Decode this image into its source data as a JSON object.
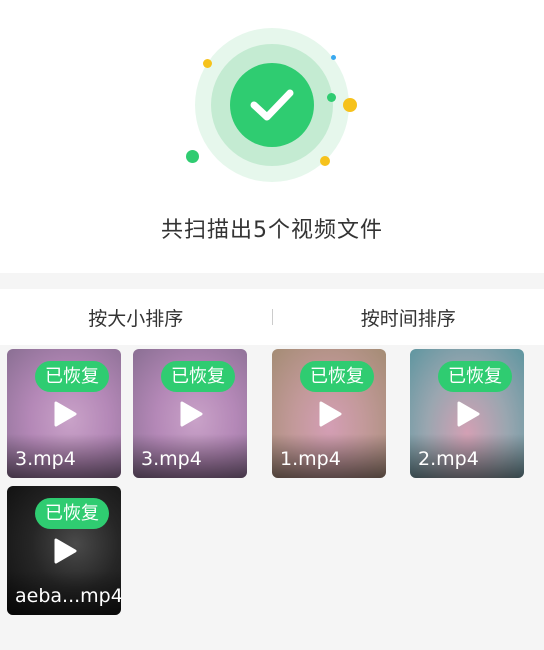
{
  "result": {
    "message": "共扫描出5个视频文件",
    "icon": "check-circle-icon",
    "accent_color": "#2fcc71"
  },
  "sort_tabs": [
    {
      "label": "按大小排序"
    },
    {
      "label": "按时间排序"
    }
  ],
  "files": [
    {
      "name": "3.mp4",
      "badge": "已恢复",
      "thumbnail": "blurred-purple-pink"
    },
    {
      "name": "3.mp4",
      "badge": "已恢复",
      "thumbnail": "blurred-purple-pink"
    },
    {
      "name": "1.mp4",
      "badge": "已恢复",
      "thumbnail": "blurred-tan-pink"
    },
    {
      "name": "2.mp4",
      "badge": "已恢复",
      "thumbnail": "blurred-teal-pink"
    },
    {
      "name": "aeba...mp4",
      "badge": "已恢复",
      "thumbnail": "dark-scene"
    }
  ]
}
